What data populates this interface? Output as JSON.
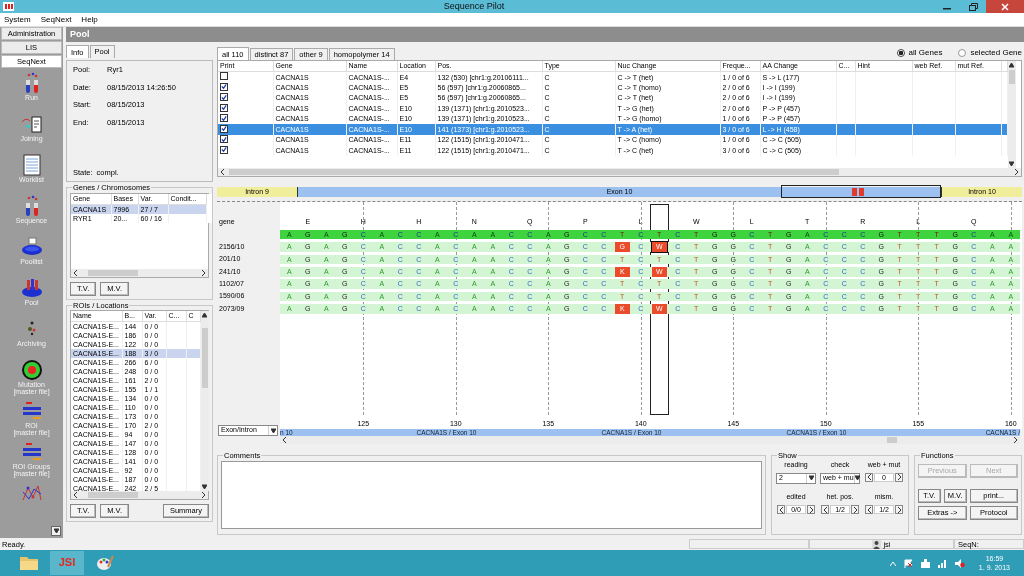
{
  "window": {
    "title": "Sequence Pilot"
  },
  "menu": [
    "System",
    "SeqNext",
    "Help"
  ],
  "nav_tabs": [
    {
      "label": "Administration",
      "selected": false
    },
    {
      "label": "LIS",
      "selected": false
    },
    {
      "label": "SeqNext",
      "selected": true
    }
  ],
  "nav_items": [
    {
      "kind": "tubes",
      "label": "Run"
    },
    {
      "kind": "joining",
      "label": "Joining"
    },
    {
      "kind": "worklist",
      "label": "Worklist"
    },
    {
      "kind": "tubes",
      "label": "Sequence"
    },
    {
      "kind": "disc",
      "label": "Poollist"
    },
    {
      "kind": "pool",
      "label": "Pool"
    },
    {
      "kind": "archive",
      "label": "Archiving"
    },
    {
      "kind": "target",
      "label": "Mutation",
      "sublabel": "[master file]"
    },
    {
      "kind": "bars",
      "label": "ROI",
      "sublabel": "[master file]"
    },
    {
      "kind": "bars",
      "label": "ROI Groups",
      "sublabel": "[master file]"
    },
    {
      "kind": "network"
    }
  ],
  "panel_title": "Pool",
  "info_tabs": [
    {
      "label": "Info",
      "selected": true
    },
    {
      "label": "Pool",
      "selected": false
    }
  ],
  "info_fields": [
    {
      "label": "Pool:",
      "value": "Ryr1"
    },
    {
      "label": "Date:",
      "value": "08/15/2013 14:26:50"
    },
    {
      "label": "Start:",
      "value": "08/15/2013"
    },
    {
      "label": "End:",
      "value": "08/15/2013"
    }
  ],
  "state": {
    "label": "State:",
    "value": "compl."
  },
  "genes": {
    "title": "Genes / Chromosomes",
    "columns": [
      "Gene",
      "Bases",
      "Var.",
      "Condit..."
    ],
    "rows": [
      {
        "cells": [
          "CACNA1S",
          "7996",
          "27 / 7",
          ""
        ],
        "selected": true
      },
      {
        "cells": [
          "RYR1",
          "20...",
          "60 / 16",
          ""
        ],
        "selected": false
      }
    ],
    "buttons": [
      "T.V.",
      "M.V."
    ]
  },
  "rois": {
    "title": "ROIs / Locations",
    "columns": [
      "Name",
      "B...",
      "Var.",
      "C...",
      "C"
    ],
    "rows": [
      {
        "cells": [
          "CACNA1S-E...",
          "144",
          "0 / 0"
        ],
        "selected": false
      },
      {
        "cells": [
          "CACNA1S-E...",
          "186",
          "0 / 0"
        ],
        "selected": false
      },
      {
        "cells": [
          "CACNA1S-E...",
          "122",
          "0 / 0"
        ],
        "selected": false
      },
      {
        "cells": [
          "CACNA1S-E...",
          "188",
          "3 / 0"
        ],
        "selected": true
      },
      {
        "cells": [
          "CACNA1S-E...",
          "266",
          "6 / 0"
        ],
        "selected": false
      },
      {
        "cells": [
          "CACNA1S-E...",
          "248",
          "0 / 0"
        ],
        "selected": false
      },
      {
        "cells": [
          "CACNA1S-E...",
          "161",
          "2 / 0"
        ],
        "selected": false
      },
      {
        "cells": [
          "CACNA1S-E...",
          "155",
          "1 / 1"
        ],
        "selected": false
      },
      {
        "cells": [
          "CACNA1S-E...",
          "134",
          "0 / 0"
        ],
        "selected": false
      },
      {
        "cells": [
          "CACNA1S-E...",
          "110",
          "0 / 0"
        ],
        "selected": false
      },
      {
        "cells": [
          "CACNA1S-E...",
          "173",
          "0 / 0"
        ],
        "selected": false
      },
      {
        "cells": [
          "CACNA1S-E...",
          "170",
          "2 / 0"
        ],
        "selected": false
      },
      {
        "cells": [
          "CACNA1S-E...",
          "94",
          "0 / 0"
        ],
        "selected": false
      },
      {
        "cells": [
          "CACNA1S-E...",
          "147",
          "0 / 0"
        ],
        "selected": false
      },
      {
        "cells": [
          "CACNA1S-E...",
          "128",
          "0 / 0"
        ],
        "selected": false
      },
      {
        "cells": [
          "CACNA1S-E...",
          "141",
          "0 / 0"
        ],
        "selected": false
      },
      {
        "cells": [
          "CACNA1S-E...",
          "92",
          "0 / 0"
        ],
        "selected": false
      },
      {
        "cells": [
          "CACNA1S-E...",
          "187",
          "0 / 0"
        ],
        "selected": false
      },
      {
        "cells": [
          "CACNA1S-E...",
          "242",
          "2 / 5"
        ],
        "selected": false
      }
    ],
    "buttons": [
      "T.V.",
      "M.V.",
      "Summary"
    ]
  },
  "variant_tabs": [
    {
      "label": "all 110",
      "selected": true
    },
    {
      "label": "distinct 87",
      "selected": false
    },
    {
      "label": "other 9",
      "selected": false
    },
    {
      "label": "homopolymer 14",
      "selected": false
    }
  ],
  "gene_filter": [
    {
      "label": "all Genes",
      "selected": true
    },
    {
      "label": "selected Gene",
      "selected": false
    }
  ],
  "variants": {
    "columns": [
      "Print",
      "Gene",
      "Name",
      "Location",
      "Pos.",
      "Type",
      "Nuc Change",
      "Freque...",
      "AA Change",
      "C...",
      "Hint",
      "web Ref.",
      "mut Ref."
    ],
    "rows": [
      {
        "print": false,
        "selected": false,
        "cells": [
          "",
          "CACNA1S",
          "CACNA1S-...",
          "E4",
          "132 (530) [chr1:g.20106111...",
          "C",
          "C -> T (het)",
          "1 / 0 of 6",
          "S -> L (177)"
        ]
      },
      {
        "print": true,
        "selected": false,
        "cells": [
          "",
          "CACNA1S",
          "CACNA1S-...",
          "E5",
          "56 (597) [chr1:g.20060865...",
          "C",
          "C -> T (homo)",
          "2 / 0 of 6",
          "I -> I (199)"
        ]
      },
      {
        "print": true,
        "selected": false,
        "cells": [
          "",
          "CACNA1S",
          "CACNA1S-...",
          "E5",
          "56 (597) [chr1:g.20060865...",
          "C",
          "C -> T (het)",
          "2 / 0 of 6",
          "I -> I (199)"
        ]
      },
      {
        "print": true,
        "selected": false,
        "cells": [
          "",
          "CACNA1S",
          "CACNA1S-...",
          "E10",
          "139 (1371) [chr1:g.2010523...",
          "C",
          "T -> G (het)",
          "2 / 0 of 6",
          "P -> P (457)"
        ]
      },
      {
        "print": true,
        "selected": false,
        "cells": [
          "",
          "CACNA1S",
          "CACNA1S-...",
          "E10",
          "139 (1371) [chr1:g.2010523...",
          "C",
          "T -> G (homo)",
          "1 / 0 of 6",
          "P -> P (457)"
        ]
      },
      {
        "print": true,
        "selected": true,
        "cells": [
          "",
          "CACNA1S",
          "CACNA1S-...",
          "E10",
          "141 (1373) [chr1:g.2010523...",
          "C",
          "T -> A (het)",
          "3 / 0 of 6",
          "L -> H (458)"
        ]
      },
      {
        "print": true,
        "selected": false,
        "cells": [
          "",
          "CACNA1S",
          "CACNA1S-...",
          "E11",
          "122 (1515) [chr1:g.2010471...",
          "C",
          "T -> C (homo)",
          "1 / 0 of 6",
          "C -> C (505)"
        ]
      },
      {
        "print": true,
        "selected": false,
        "cells": [
          "",
          "CACNA1S",
          "CACNA1S-...",
          "E11",
          "122 (1515) [chr1:g.2010471...",
          "C",
          "T -> C (het)",
          "3 / 0 of 6",
          "C -> C (505)"
        ]
      }
    ]
  },
  "exon_bar": [
    {
      "kind": "intron",
      "label": "Intron 9"
    },
    {
      "kind": "exon",
      "label": "Exon 10"
    },
    {
      "kind": "intron",
      "label": "Intron 10"
    }
  ],
  "sequence": {
    "reference_label": "gene",
    "amino_acids": [
      "E",
      "H",
      "H",
      "N",
      "Q",
      "P",
      "L",
      "W",
      "L",
      "T",
      "R",
      "L",
      "Q"
    ],
    "rows": [
      {
        "kind": "reference",
        "bases": [
          "A",
          "G",
          "A",
          "G",
          "C",
          "A",
          "C",
          "C",
          "A",
          "C",
          "A",
          "A",
          "C",
          "C",
          "A",
          "G",
          "C",
          "C",
          "T",
          "C",
          {
            "base": "T",
            "cursor": true
          },
          "C",
          "T",
          "G",
          "G",
          "C",
          "T",
          "G",
          "A",
          "C",
          "C",
          "C",
          "G",
          "T",
          "T",
          "T",
          "G",
          "C",
          "A",
          "A"
        ]
      },
      {
        "kind": "sample",
        "label": "2156/10",
        "bases": [
          "A",
          "G",
          "A",
          "G",
          "C",
          "A",
          "C",
          "C",
          "A",
          "C",
          "A",
          "A",
          "C",
          "C",
          "A",
          "G",
          "C",
          "C",
          {
            "base": "G",
            "variant": true
          },
          "C",
          {
            "base": "W",
            "variant": true,
            "cursor": true
          },
          "C",
          "T",
          "G",
          "G",
          "C",
          "T",
          "G",
          "A",
          "C",
          "C",
          "C",
          "G",
          "T",
          "T",
          "T",
          "G",
          "C",
          "A",
          "A"
        ]
      },
      {
        "kind": "sample",
        "label": "201/10",
        "bases": [
          "A",
          "G",
          "A",
          "G",
          "C",
          "A",
          "C",
          "C",
          "A",
          "C",
          "A",
          "A",
          "C",
          "C",
          "A",
          "G",
          "C",
          "C",
          "T",
          "C",
          "T",
          "C",
          "T",
          "G",
          "G",
          "C",
          "T",
          "G",
          "A",
          "C",
          "C",
          "C",
          "G",
          "T",
          "T",
          "T",
          "G",
          "C",
          "A",
          "A"
        ]
      },
      {
        "kind": "sample",
        "label": "241/10",
        "bases": [
          "A",
          "G",
          "A",
          "G",
          "C",
          "A",
          "C",
          "C",
          "A",
          "C",
          "A",
          "A",
          "C",
          "C",
          "A",
          "G",
          "C",
          "C",
          {
            "base": "K",
            "variant": true
          },
          "C",
          {
            "base": "W",
            "variant": true
          },
          "C",
          "T",
          "G",
          "G",
          "C",
          "T",
          "G",
          "A",
          "C",
          "C",
          "C",
          "G",
          "T",
          "T",
          "T",
          "G",
          "C",
          "A",
          "A"
        ]
      },
      {
        "kind": "sample",
        "label": "1102/07",
        "bases": [
          "A",
          "G",
          "A",
          "G",
          "C",
          "A",
          "C",
          "C",
          "A",
          "C",
          "A",
          "A",
          "C",
          "C",
          "A",
          "G",
          "C",
          "C",
          "T",
          "C",
          "T",
          "C",
          "T",
          "G",
          "G",
          "C",
          "T",
          "G",
          "A",
          "C",
          "C",
          "C",
          "G",
          "T",
          "T",
          "T",
          "G",
          "C",
          "A",
          "A"
        ]
      },
      {
        "kind": "sample",
        "label": "1590/06",
        "bases": [
          "A",
          "G",
          "A",
          "G",
          "C",
          "A",
          "C",
          "C",
          "A",
          "C",
          "A",
          "A",
          "C",
          "C",
          "A",
          "G",
          "C",
          "C",
          "T",
          "C",
          "T",
          "C",
          "T",
          "G",
          "G",
          "C",
          "T",
          "G",
          "A",
          "C",
          "C",
          "C",
          "G",
          "T",
          "T",
          "T",
          "G",
          "C",
          "A",
          "A"
        ]
      },
      {
        "kind": "sample",
        "label": "2073/09",
        "bases": [
          "A",
          "G",
          "A",
          "G",
          "C",
          "A",
          "C",
          "C",
          "A",
          "C",
          "A",
          "A",
          "C",
          "C",
          "A",
          "G",
          "C",
          "C",
          {
            "base": "K",
            "variant": true
          },
          "C",
          {
            "base": "W",
            "variant": true
          },
          "C",
          "T",
          "G",
          "G",
          "C",
          "T",
          "G",
          "A",
          "C",
          "C",
          "C",
          "G",
          "T",
          "T",
          "T",
          "G",
          "C",
          "A",
          "A"
        ]
      }
    ],
    "ticks": [
      "125",
      "130",
      "135",
      "140",
      "145",
      "150",
      "155",
      "160"
    ],
    "region_labels": [
      "n 10",
      "CACNA1S / Exon 10",
      "CACNA1S / Exon 10",
      "CACNA1S / Exon 10",
      "CACNA1S /"
    ]
  },
  "view_select": "Exon/Intron",
  "comments": {
    "title": "Comments"
  },
  "show": {
    "title": "Show",
    "controls": [
      {
        "label": "reading",
        "kind": "dropdown",
        "value": "2"
      },
      {
        "label": "check",
        "kind": "dropdown",
        "value": "web + mu"
      },
      {
        "label": "web + mut",
        "kind": "spinner",
        "value": "0"
      },
      {
        "label": "edited",
        "kind": "spinner",
        "value": "0/0"
      },
      {
        "label": "het. pos.",
        "kind": "spinner",
        "value": "1/2"
      },
      {
        "label": "mism.",
        "kind": "spinner",
        "value": "1/2"
      }
    ]
  },
  "functions": {
    "title": "Functions",
    "buttons": [
      {
        "label": "Previous",
        "disabled": true
      },
      {
        "label": "Next",
        "disabled": true
      },
      {
        "label": "T.V.",
        "disabled": false
      },
      {
        "label": "M.V.",
        "disabled": false
      },
      {
        "label": "print...",
        "disabled": false
      },
      {
        "label": "Extras ->",
        "disabled": false
      },
      {
        "label": "Protocol",
        "disabled": false
      }
    ]
  },
  "status_bar": {
    "text": "Ready.",
    "user": "jsi",
    "seq_label": "SeqN:"
  },
  "taskbar": {
    "active_app": "JSI",
    "time": "16:59",
    "date": "1. 9. 2013"
  }
}
